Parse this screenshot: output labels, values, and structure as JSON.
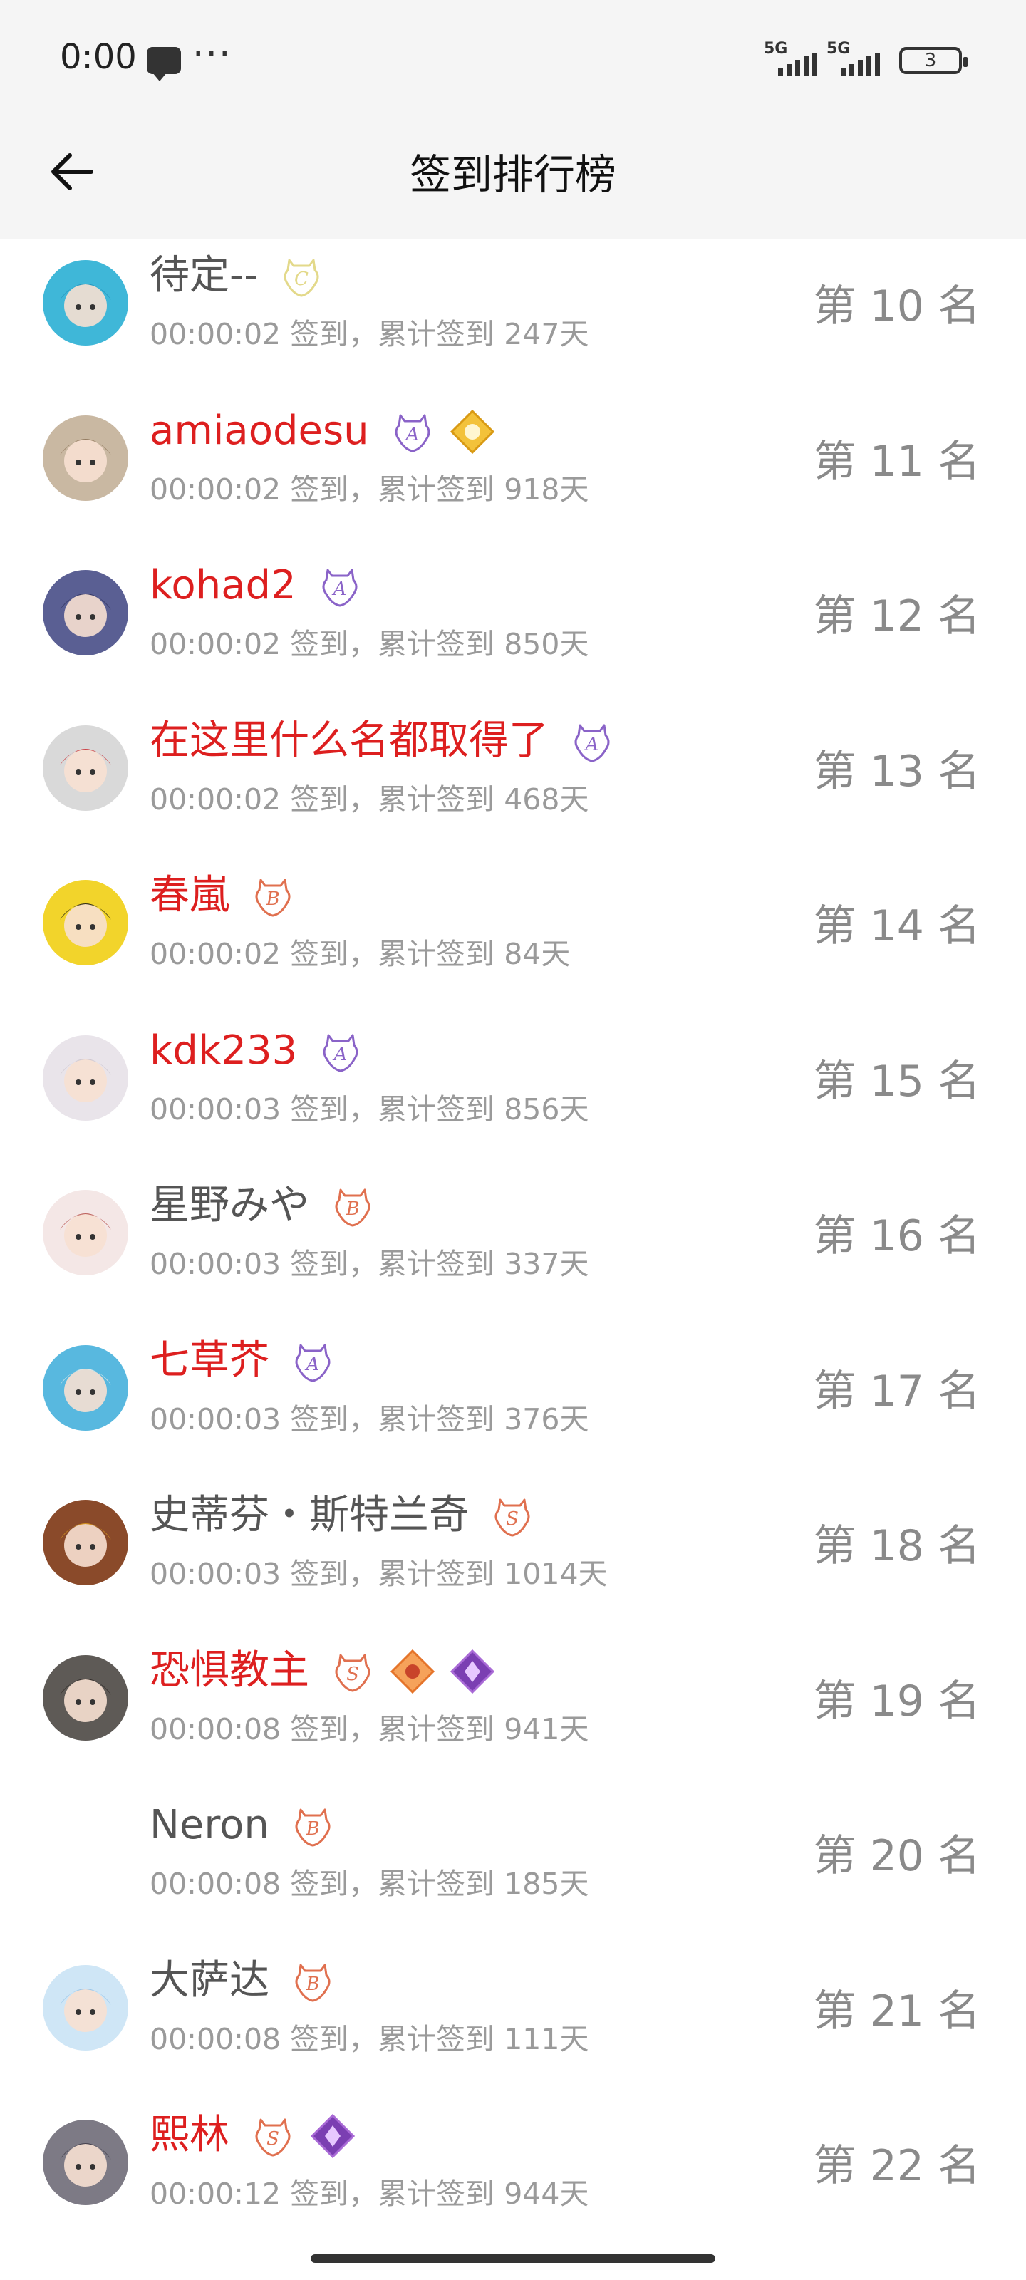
{
  "status_bar": {
    "time": "0:00",
    "network_1": "5G",
    "network_2": "5G",
    "battery": "3"
  },
  "header": {
    "title": "签到排行榜"
  },
  "entries": [
    {
      "name": "待定--",
      "name_color": "gray",
      "checkin": "00:00:02 签到，累计签到 247天",
      "rank": "第 10 名",
      "avatar_color": "#3fb7d8",
      "badges": [
        "C"
      ]
    },
    {
      "name": "amiaodesu",
      "name_color": "red",
      "checkin": "00:00:02 签到，累计签到 918天",
      "rank": "第 11 名",
      "avatar_color": "#c9b8a2",
      "badges": [
        "A",
        "gold"
      ]
    },
    {
      "name": "kohad2",
      "name_color": "red",
      "checkin": "00:00:02 签到，累计签到 850天",
      "rank": "第 12 名",
      "avatar_color": "#5a5f93",
      "badges": [
        "A"
      ]
    },
    {
      "name": "在这里什么名都取得了",
      "name_color": "red",
      "checkin": "00:00:02 签到，累计签到 468天",
      "rank": "第 13 名",
      "avatar_color": "#d9d9d9",
      "badges": [
        "A"
      ]
    },
    {
      "name": "春嵐",
      "name_color": "red",
      "checkin": "00:00:02 签到，累计签到 84天",
      "rank": "第 14 名",
      "avatar_color": "#f2d42b",
      "badges": [
        "B"
      ]
    },
    {
      "name": "kdk233",
      "name_color": "red",
      "checkin": "00:00:03 签到，累计签到 856天",
      "rank": "第 15 名",
      "avatar_color": "#e9e4ea",
      "badges": [
        "A"
      ]
    },
    {
      "name": "星野みや",
      "name_color": "gray",
      "checkin": "00:00:03 签到，累计签到 337天",
      "rank": "第 16 名",
      "avatar_color": "#f4e7e6",
      "badges": [
        "B"
      ]
    },
    {
      "name": "七草芥",
      "name_color": "red",
      "checkin": "00:00:03 签到，累计签到 376天",
      "rank": "第 17 名",
      "avatar_color": "#58b8df",
      "badges": [
        "A"
      ]
    },
    {
      "name": "史蒂芬・斯特兰奇",
      "name_color": "gray",
      "checkin": "00:00:03 签到，累计签到 1014天",
      "rank": "第 18 名",
      "avatar_color": "#8a4a2a",
      "badges": [
        "S"
      ]
    },
    {
      "name": "恐惧教主",
      "name_color": "red",
      "checkin": "00:00:08 签到，累计签到 941天",
      "rank": "第 19 名",
      "avatar_color": "#5e5a56",
      "badges": [
        "S",
        "orange",
        "purple"
      ]
    },
    {
      "name": "Neron",
      "name_color": "gray",
      "checkin": "00:00:08 签到，累计签到 185天",
      "rank": "第 20 名",
      "avatar_color": "#ffffff",
      "badges": [
        "B"
      ]
    },
    {
      "name": "大萨达",
      "name_color": "gray",
      "checkin": "00:00:08 签到，累计签到 111天",
      "rank": "第 21 名",
      "avatar_color": "#cfe6f6",
      "badges": [
        "B"
      ]
    },
    {
      "name": "熙林",
      "name_color": "red",
      "checkin": "00:00:12 签到，累计签到 944天",
      "rank": "第 22 名",
      "avatar_color": "#7d7a85",
      "badges": [
        "S",
        "purple"
      ]
    }
  ],
  "colors": {
    "name_red": "#dd1f1f",
    "name_gray": "#555555",
    "badge_A": "#8a63c8",
    "badge_B": "#e0704f",
    "badge_C": "#e3d98a",
    "badge_S": "#e0704f"
  }
}
